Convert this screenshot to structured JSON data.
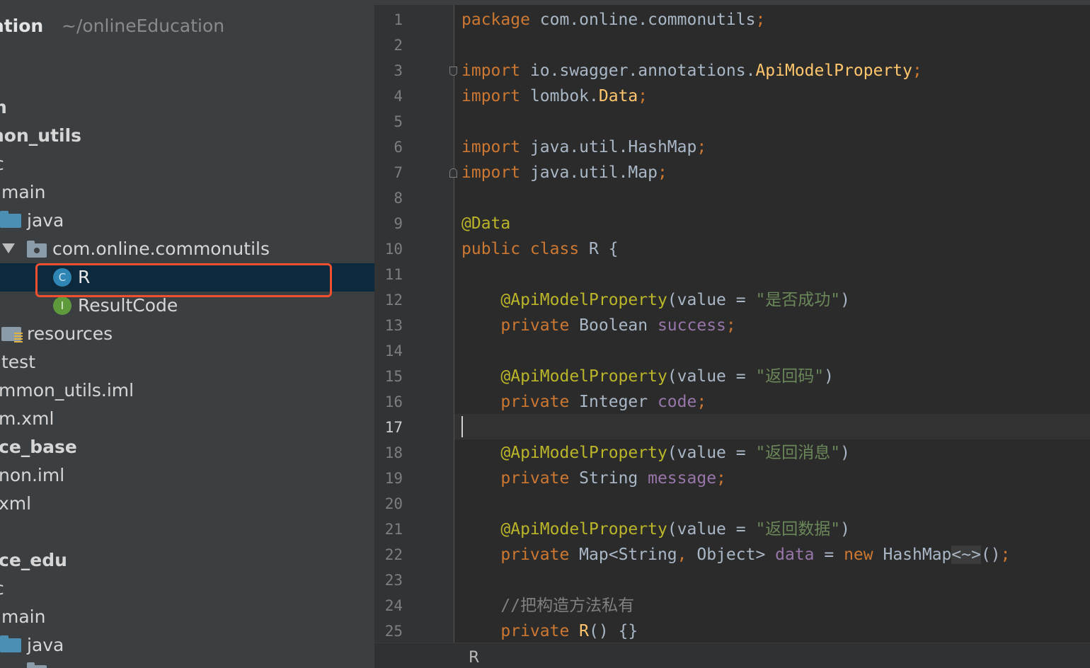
{
  "project": {
    "name": "cation",
    "path": "~/onlineEducation"
  },
  "tree": {
    "row_n": "n",
    "common_utils": "non_utils",
    "src1": "c",
    "main1": "main",
    "java1": "java",
    "package": "com.online.commonutils",
    "class_r": "R",
    "class_r_icon_letter": "C",
    "result_code": "ResultCode",
    "result_code_icon_letter": "I",
    "resources": "resources",
    "test": "test",
    "common_utils_iml": "mmon_utils.iml",
    "pom_xml": "m.xml",
    "service_base": "ce_base",
    "common_iml": "non.iml",
    "xml": "xml",
    "service_edu": "ce_edu",
    "src2": "c",
    "main2": "main",
    "java2": "java"
  },
  "editor": {
    "line_numbers": [
      "1",
      "2",
      "3",
      "4",
      "5",
      "6",
      "7",
      "8",
      "9",
      "10",
      "11",
      "12",
      "13",
      "14",
      "15",
      "16",
      "17",
      "18",
      "19",
      "20",
      "21",
      "22",
      "23",
      "24",
      "25"
    ],
    "current_line": "17",
    "code": {
      "l1": {
        "kw": "package",
        "rest": " com.online.commonutils",
        "semi": ";"
      },
      "l3": {
        "kw": "import",
        "pkg": " io.swagger.annotations.",
        "cls": "ApiModelProperty",
        "semi": ";"
      },
      "l4": {
        "kw": "import",
        "pkg": " lombok.",
        "cls": "Data",
        "semi": ";"
      },
      "l6": {
        "kw": "import",
        "pkg": " java.util.HashMap",
        "semi": ";"
      },
      "l7": {
        "kw": "import",
        "pkg": " java.util.Map",
        "semi": ";"
      },
      "l9": {
        "ann": "@Data"
      },
      "l10": {
        "kw": "public class",
        "rest": " R {"
      },
      "l12": {
        "ann": "@ApiModelProperty",
        "open": "(",
        "param": "value",
        "eq": " = ",
        "str": "\"是否成功\"",
        "close": ")"
      },
      "l13": {
        "kw": "private",
        "type": " Boolean ",
        "fld": "success",
        "semi": ";"
      },
      "l15": {
        "ann": "@ApiModelProperty",
        "open": "(",
        "param": "value",
        "eq": " = ",
        "str": "\"返回码\"",
        "close": ")"
      },
      "l16": {
        "kw": "private",
        "type": " Integer ",
        "fld": "code",
        "semi": ";"
      },
      "l18": {
        "ann": "@ApiModelProperty",
        "open": "(",
        "param": "value",
        "eq": " = ",
        "str": "\"返回消息\"",
        "close": ")"
      },
      "l19": {
        "kw": "private",
        "type": " String ",
        "fld": "message",
        "semi": ";"
      },
      "l21": {
        "ann": "@ApiModelProperty",
        "open": "(",
        "param": "value",
        "eq": " = ",
        "str": "\"返回数据\"",
        "close": ")"
      },
      "l22": {
        "kw": "private",
        "type": " Map<String",
        "comma": ",",
        "type2": " Object> ",
        "fld": "data",
        "eq": " = ",
        "kw2": "new",
        "type3": " HashMap",
        "diamond": "<~>",
        "call": "()",
        "semi": ";"
      },
      "l24": {
        "cmt": "//把构造方法私有"
      },
      "l25": {
        "kw": "private",
        "cls": " R",
        "rest": "() {}"
      }
    },
    "breadcrumb": "R"
  }
}
